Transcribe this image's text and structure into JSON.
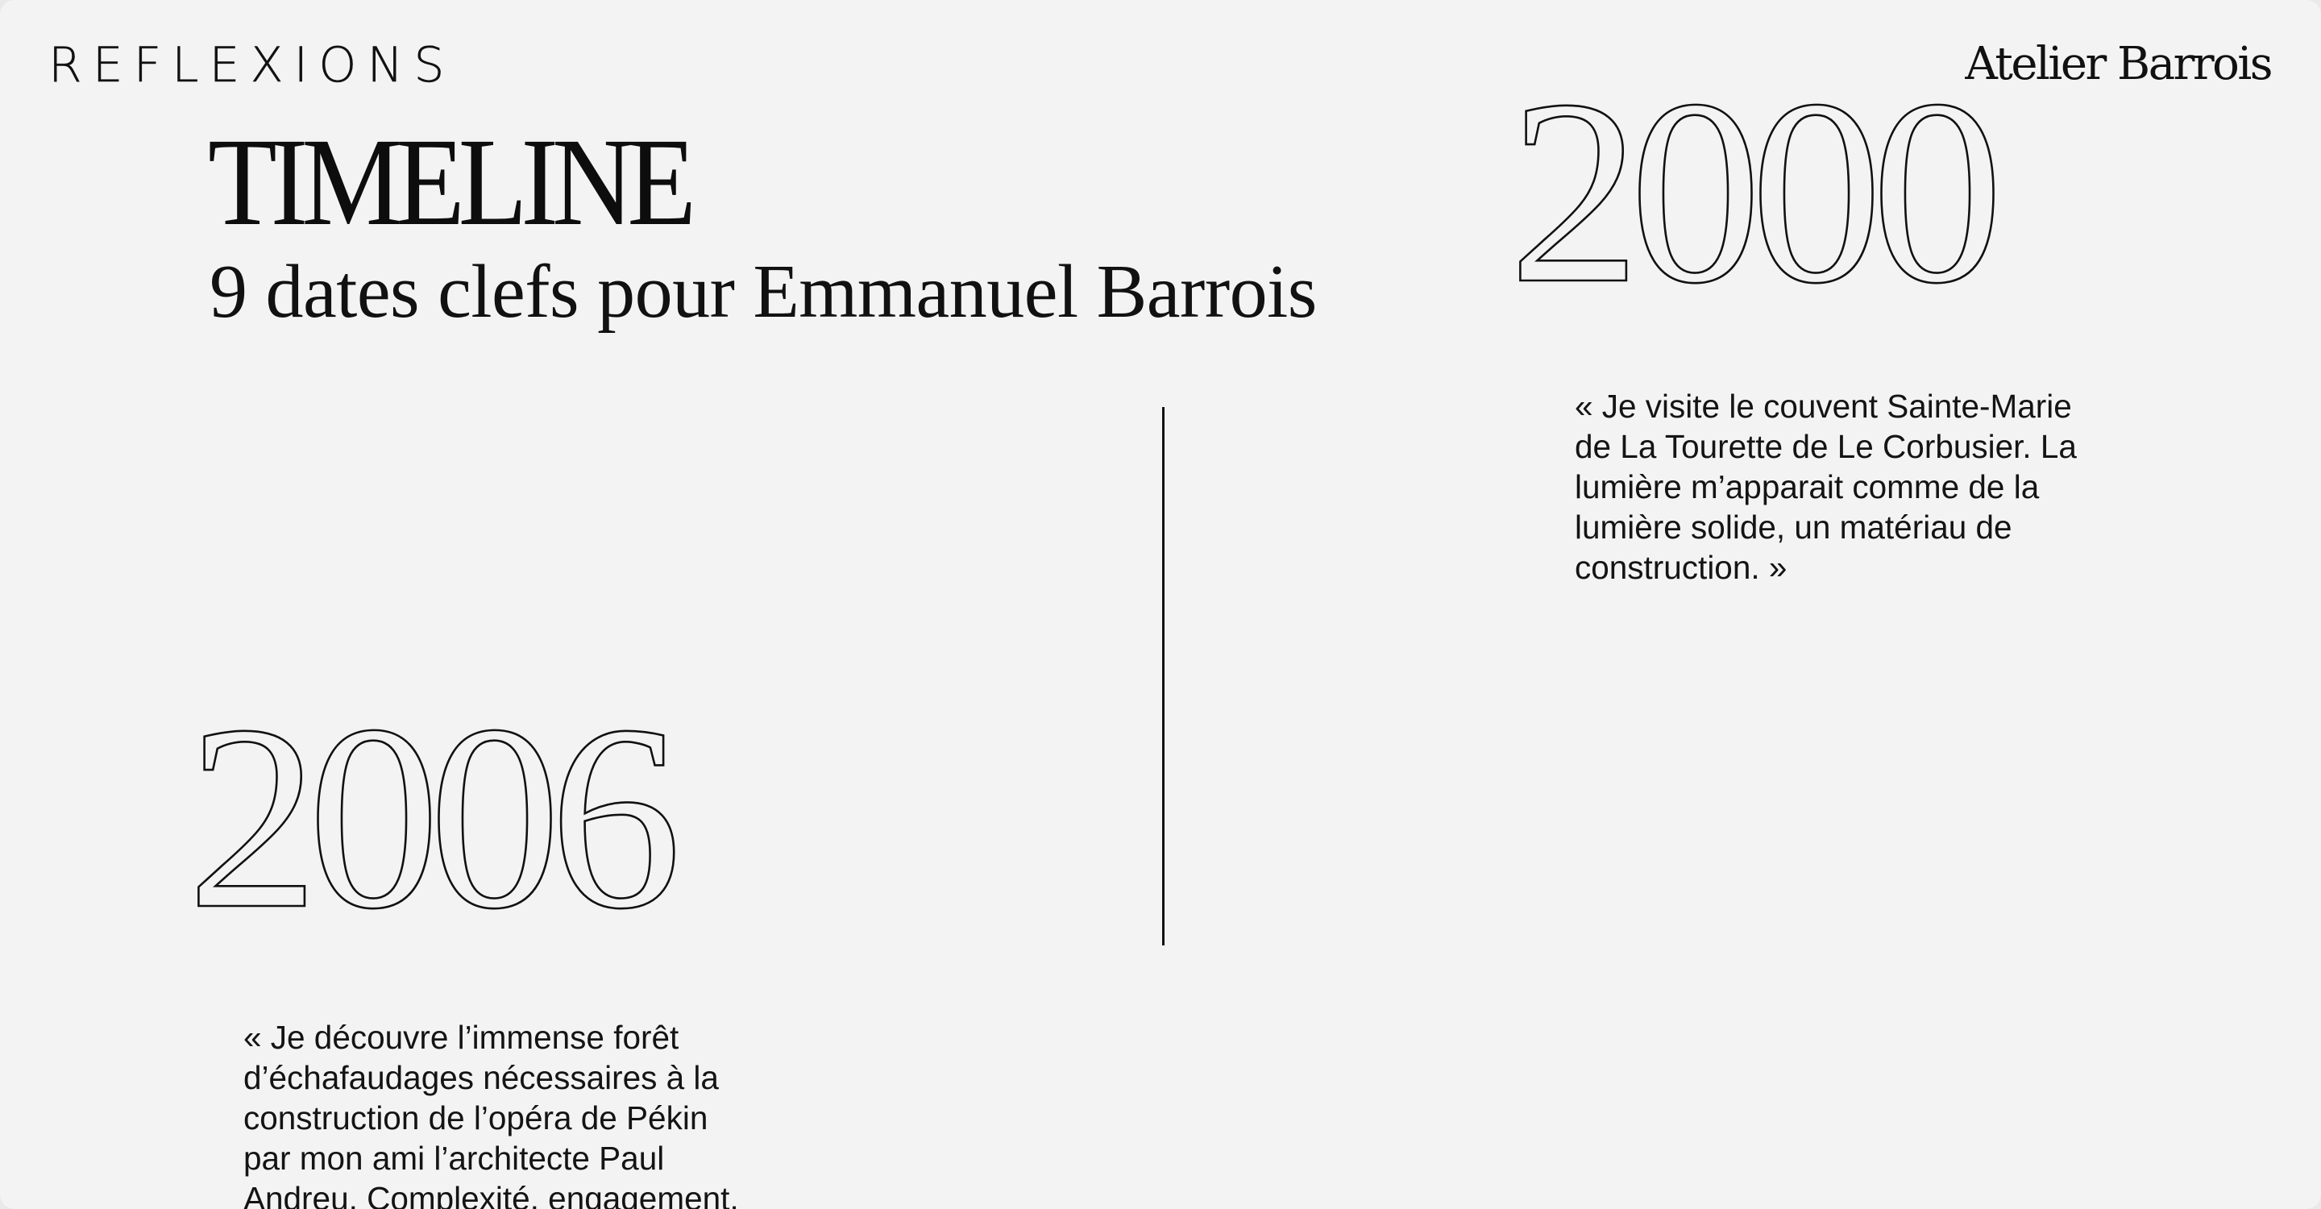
{
  "header": {
    "menu_label": "REFLEXIONS",
    "brand": "Atelier Barrois"
  },
  "hero": {
    "title": "TIMELINE",
    "subtitle": "9 dates clefs pour Emmanuel Barrois"
  },
  "timeline": {
    "entries": [
      {
        "year": "2000",
        "text": "« Je visite le couvent Sainte-Marie de La Tourette de Le Corbusier. La lumière m’apparait comme de la lumière solide, un matériau de construction. »"
      },
      {
        "year": "2006",
        "text": "« Je découvre l’immense forêt d’échafaudages nécessaires à la construction de l’opéra de Pékin par mon ami l’architecte Paul Andreu. Complexité, engagement,"
      }
    ]
  }
}
